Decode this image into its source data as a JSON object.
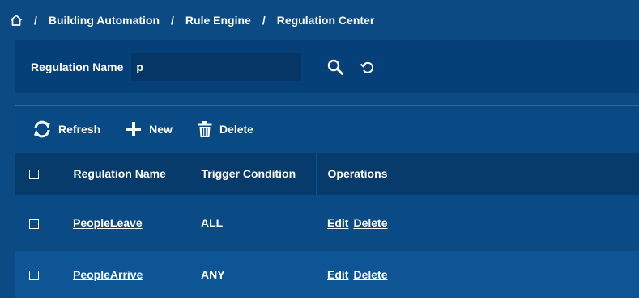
{
  "breadcrumb": {
    "home_icon": "home-icon",
    "separator": "/",
    "items": [
      "Building Automation",
      "Rule Engine",
      "Regulation Center"
    ]
  },
  "search": {
    "label": "Regulation Name",
    "value": "p",
    "search_icon": "search-icon",
    "reset_icon": "reset-icon"
  },
  "toolbar": {
    "refresh_label": "Refresh",
    "new_label": "New",
    "delete_label": "Delete"
  },
  "table": {
    "columns": [
      "Regulation Name",
      "Trigger Condition",
      "Operations"
    ],
    "rows": [
      {
        "name": "PeopleLeave",
        "trigger": "ALL",
        "edit": "Edit",
        "delete": "Delete"
      },
      {
        "name": "PeopleArrive",
        "trigger": "ANY",
        "edit": "Edit",
        "delete": "Delete"
      }
    ]
  },
  "colors": {
    "background": "#0b4a82",
    "panel": "#064078",
    "header": "#063b6c"
  }
}
